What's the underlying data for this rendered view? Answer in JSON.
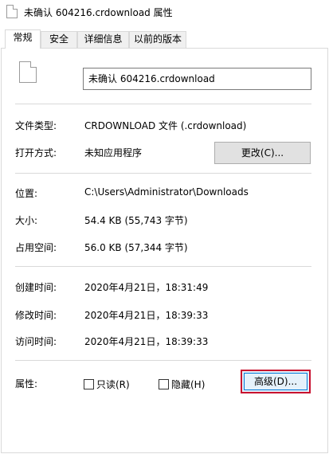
{
  "window": {
    "title": "未确认 604216.crdownload 属性"
  },
  "tabs": [
    {
      "label": "常规",
      "active": true
    },
    {
      "label": "安全",
      "active": false
    },
    {
      "label": "详细信息",
      "active": false
    },
    {
      "label": "以前的版本",
      "active": false
    }
  ],
  "general": {
    "file_name": "未确认 604216.crdownload",
    "file_type_label": "文件类型:",
    "file_type_value": "CRDOWNLOAD 文件 (.crdownload)",
    "opens_with_label": "打开方式:",
    "opens_with_value": "未知应用程序",
    "change_button": "更改(C)...",
    "location_label": "位置:",
    "location_value": "C:\\Users\\Administrator\\Downloads",
    "size_label": "大小:",
    "size_value": "54.4 KB (55,743 字节)",
    "size_on_disk_label": "占用空间:",
    "size_on_disk_value": "56.0 KB (57,344 字节)",
    "created_label": "创建时间:",
    "created_value": "2020年4月21日，18:31:49",
    "modified_label": "修改时间:",
    "modified_value": "2020年4月21日，18:39:33",
    "accessed_label": "访问时间:",
    "accessed_value": "2020年4月21日，18:39:33",
    "attributes_label": "属性:",
    "readonly_label": "只读(R)",
    "readonly_checked": false,
    "hidden_label": "隐藏(H)",
    "hidden_checked": false,
    "advanced_button": "高级(D)..."
  },
  "colors": {
    "highlight_border": "#c8102e",
    "focus_border": "#0078d7"
  }
}
